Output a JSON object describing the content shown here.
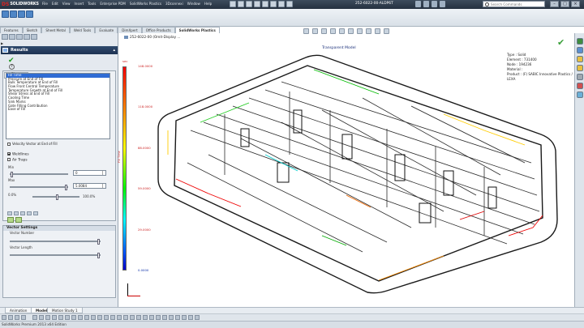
{
  "app": {
    "logo_brand": "DS",
    "logo_text": "SOLIDWORKS",
    "document_title": "252-6022-00-ALDP6T",
    "search_placeholder": "Search Commands",
    "status_text": "SolidWorks Premium 2013 x64 Edition"
  },
  "menu": [
    "File",
    "Edit",
    "View",
    "Insert",
    "Tools",
    "Enterprise PDM",
    "SolidWorks Plastics",
    "3Dconnexi",
    "Window",
    "Help"
  ],
  "command_tabs": [
    {
      "label": "Features",
      "active": false
    },
    {
      "label": "Sketch",
      "active": false
    },
    {
      "label": "Sheet Metal",
      "active": false
    },
    {
      "label": "Weld Tools",
      "active": false
    },
    {
      "label": "Evaluate",
      "active": false
    },
    {
      "label": "DimXpert",
      "active": false
    },
    {
      "label": "Office Products",
      "active": false
    },
    {
      "label": "SolidWorks Plastics",
      "active": true
    }
  ],
  "panel": {
    "tree_label": "▶",
    "results_title": "Results",
    "flow_group_label": "Flow",
    "result_items": [
      {
        "label": "Fill Time",
        "selected": true
      },
      {
        "label": "Pressure at End of Fill",
        "selected": false
      },
      {
        "label": "Bulk Temperature at End of Fill",
        "selected": false
      },
      {
        "label": "Flow Front Central Temperature",
        "selected": false
      },
      {
        "label": "Temperature Growth at End of Fill",
        "selected": false
      },
      {
        "label": "Shear Stress at End of Fill",
        "selected": false
      },
      {
        "label": "Cooling Time",
        "selected": false
      },
      {
        "label": "Sink Marks",
        "selected": false
      },
      {
        "label": "Gate Filling Contribution",
        "selected": false
      },
      {
        "label": "Ease of Fill",
        "selected": false
      }
    ],
    "velocity_label": "Velocity Vector at End of Fill",
    "weldlines_label": "Weldlines",
    "air_traps_label": "Air Traps",
    "min_label": "Min",
    "min_value": "0",
    "max_label": "Max",
    "max_value": "5.0084",
    "range_left": "0.0%",
    "range_right": "100.0%",
    "vector_settings_title": "Vector Settings",
    "vector_number_label": "Vector Number",
    "vector_length_label": "Vector Length"
  },
  "bottom_tabs": [
    {
      "label": "Animation",
      "active": false
    },
    {
      "label": "Model",
      "active": true
    },
    {
      "label": "Motion Study 1",
      "active": false
    }
  ],
  "viewport": {
    "part_label": "252-6022-00 (Omit-Display ...",
    "plot_title": "Transparent Model",
    "info_lines": [
      "Type : Solid",
      "Element : 731400",
      "Node : 194236",
      "Material :",
      "Product : (F) SABIC Innovative Plastics / LEXA"
    ],
    "colorbar_unit": "sec",
    "colorbar_ticks": [
      "148.0000",
      "118.0000",
      "88.0000",
      "59.0000",
      "29.0000",
      "0.0000"
    ],
    "colorbar_axis_label": "Fill Time",
    "colorbar_colors": [
      "#ff0000",
      "#ffff00",
      "#00ff00",
      "#00ffff",
      "#0000c8"
    ]
  }
}
